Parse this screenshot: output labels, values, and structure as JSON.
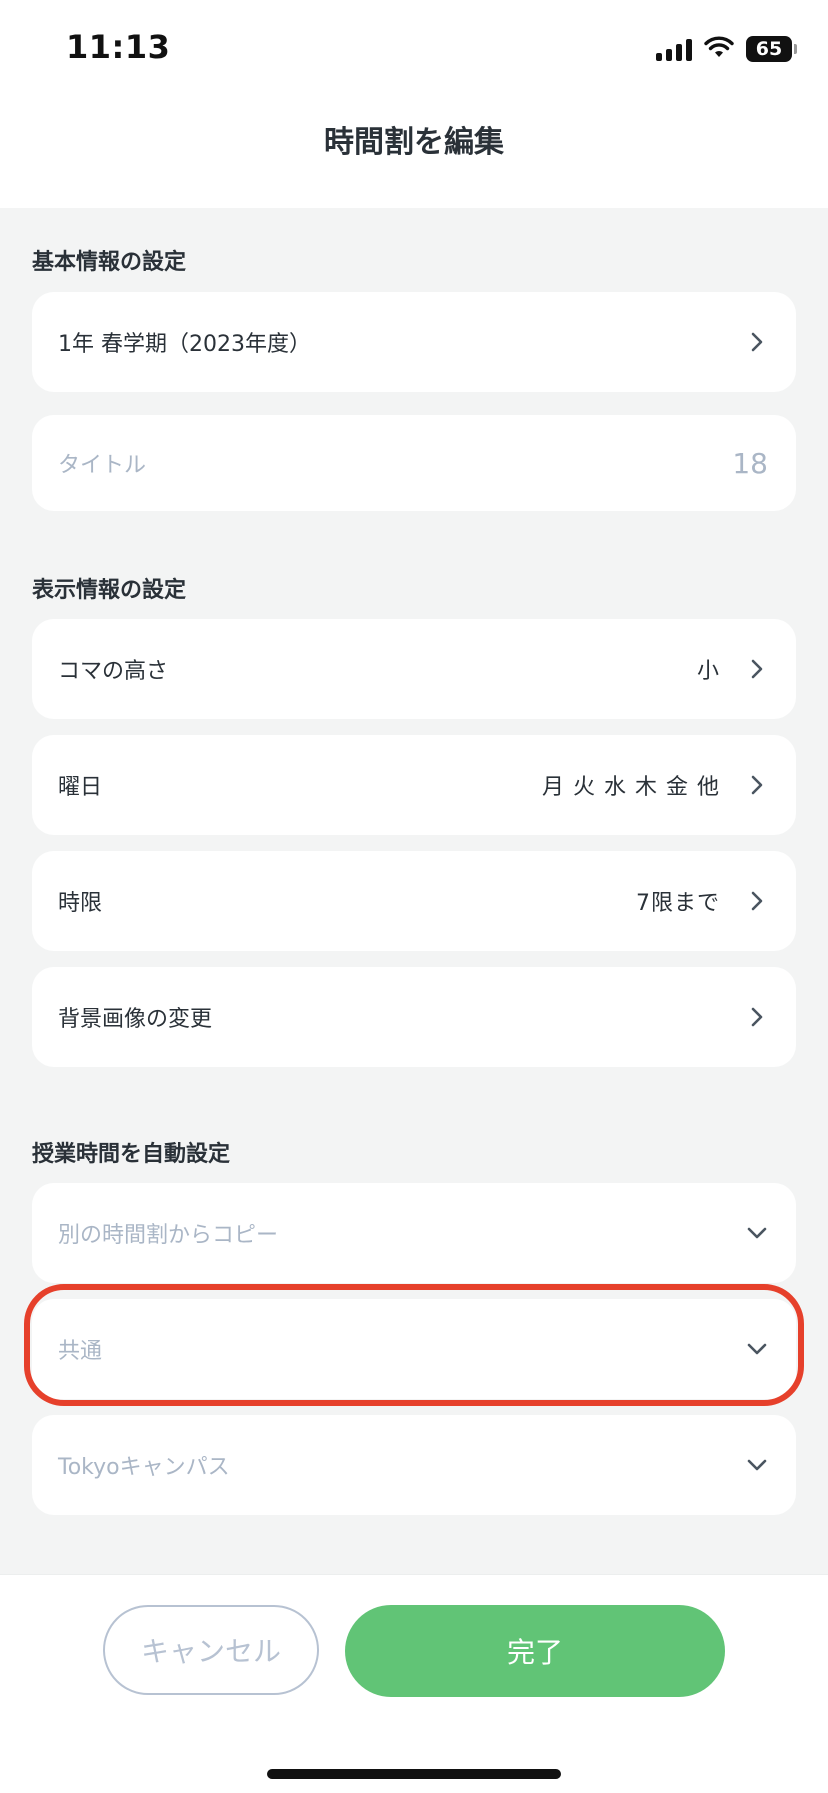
{
  "status": {
    "time": "11:13",
    "battery": "65"
  },
  "nav": {
    "title": "時間割を編集"
  },
  "basic": {
    "section_title": "基本情報の設定",
    "term_label": "1年 春学期（2023年度）",
    "title_placeholder": "タイトル",
    "title_count": "18"
  },
  "display": {
    "section_title": "表示情報の設定",
    "cell_height_label": "コマの高さ",
    "cell_height_value": "小",
    "weekday_label": "曜日",
    "weekday_value": "月 火 水 木 金 他",
    "period_label": "時限",
    "period_value": "7限まで",
    "background_label": "背景画像の変更"
  },
  "auto": {
    "section_title": "授業時間を自動設定",
    "copy_placeholder": "別の時間割からコピー",
    "common_placeholder": "共通",
    "campus_placeholder": "Tokyoキャンパス"
  },
  "footer": {
    "cancel_label": "キャンセル",
    "done_label": "完了"
  },
  "colors": {
    "accent": "#61c476",
    "highlight": "#e6402b",
    "placeholder": "#aab6c6"
  }
}
